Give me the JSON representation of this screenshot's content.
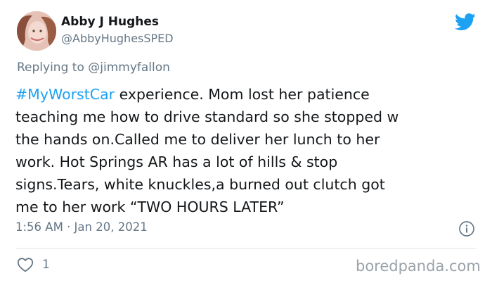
{
  "author": {
    "display_name": "Abby J Hughes",
    "handle": "@AbbyHughesSPED"
  },
  "reply": {
    "prefix": "Replying to ",
    "mention": "@jimmyfallon"
  },
  "tweet": {
    "hashtag": "#MyWorstCar",
    "lines": [
      " experience. Mom lost her patience",
      "teaching me how to drive standard so she stopped w",
      "the hands on.Called me to deliver her lunch to her",
      "work. Hot Springs AR has a lot of hills & stop",
      "signs.Tears, white knuckles,a burned out clutch got",
      "me to her work “TWO HOURS LATER”"
    ]
  },
  "meta": {
    "timestamp": "1:56 AM · Jan 20, 2021",
    "like_count": "1"
  },
  "watermark": "boredpanda.com",
  "colors": {
    "brand_blue": "#1da1f2",
    "secondary_text": "#657786",
    "primary_text": "#14171a",
    "divider": "#e1e8ed"
  },
  "icons": {
    "brand": "twitter-bird-icon",
    "info": "info-icon",
    "like": "heart-icon"
  }
}
